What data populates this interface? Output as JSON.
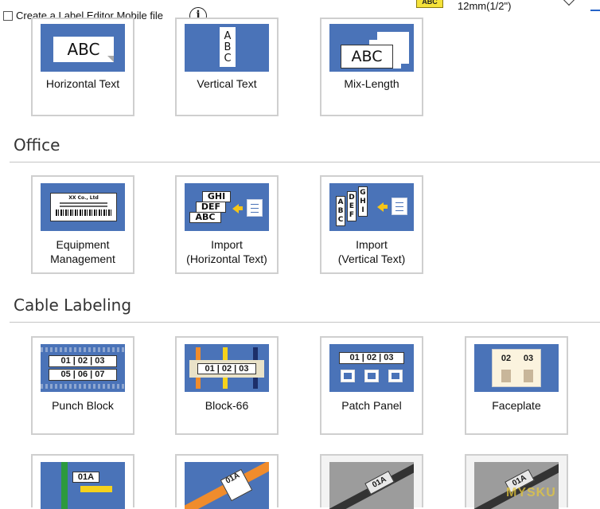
{
  "topbar": {
    "checkbox_label": "Create a Label Editor Mobile file",
    "info_glyph": "i",
    "tape_badge": "ABC",
    "tape_size": "12mm(1/2\")"
  },
  "top_tiles": {
    "horizontal": {
      "label": "Horizontal Text",
      "sample": "ABC"
    },
    "vertical": {
      "label": "Vertical Text",
      "sample": [
        "A",
        "B",
        "C"
      ]
    },
    "mix": {
      "label": "Mix-Length",
      "sample": "ABC"
    }
  },
  "office": {
    "title": "Office",
    "equipment": {
      "label_line1": "Equipment",
      "label_line2": "Management",
      "mini_title": "XX Co., Ltd"
    },
    "import_h": {
      "label_line1": "Import",
      "label_line2": "(Horizontal Text)",
      "samples": [
        "GHI",
        "DEF",
        "ABC"
      ]
    },
    "import_v": {
      "label_line1": "Import",
      "label_line2": "(Vertical Text)",
      "samples": [
        "ABC",
        "DEF",
        "GHI"
      ]
    }
  },
  "cable": {
    "title": "Cable Labeling",
    "punch": {
      "label": "Punch Block",
      "row1": "01 | 02 | 03",
      "row2": "05 | 06 | 07"
    },
    "block66": {
      "label": "Block-66",
      "row": "01 | 02 | 03"
    },
    "patch": {
      "label": "Patch Panel",
      "row": "01 | 02 | 03"
    },
    "faceplate": {
      "label": "Faceplate",
      "left": "02",
      "right": "03"
    },
    "cable_a": {
      "sample": "01A"
    },
    "cable_b": {
      "sample": "01A"
    },
    "cable_c": {
      "sample": "01A"
    },
    "cable_d": {
      "sample": "01A"
    }
  },
  "watermark": "MYSKU"
}
